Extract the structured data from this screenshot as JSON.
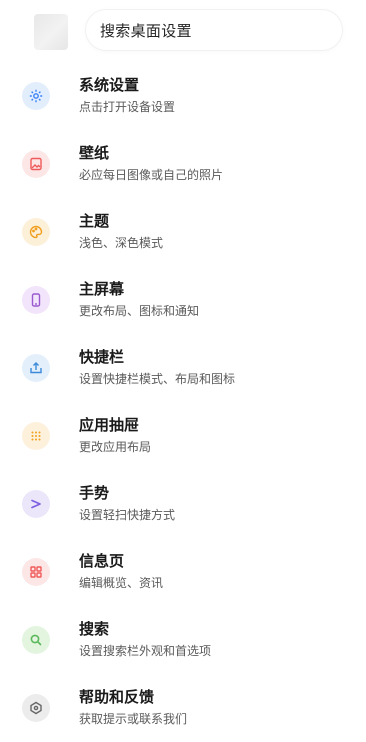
{
  "search": {
    "placeholder": "搜索桌面设置"
  },
  "items": [
    {
      "title": "系统设置",
      "subtitle": "点击打开设备设置",
      "icon": "gear-icon",
      "icon_color": "#3b82f6",
      "bg_color": "#e3eefc"
    },
    {
      "title": "壁纸",
      "subtitle": "必应每日图像或自己的照片",
      "icon": "picture-icon",
      "icon_color": "#ef5a5a",
      "bg_color": "#fde6e6"
    },
    {
      "title": "主题",
      "subtitle": "浅色、深色模式",
      "icon": "palette-icon",
      "icon_color": "#f0a020",
      "bg_color": "#fdf0d8"
    },
    {
      "title": "主屏幕",
      "subtitle": "更改布局、图标和通知",
      "icon": "phone-icon",
      "icon_color": "#9b59d0",
      "bg_color": "#f1e4fb"
    },
    {
      "title": "快捷栏",
      "subtitle": "设置快捷栏模式、布局和图标",
      "icon": "upload-tray-icon",
      "icon_color": "#3b8ad8",
      "bg_color": "#e3effb"
    },
    {
      "title": "应用抽屉",
      "subtitle": "更改应用布局",
      "icon": "grid-dots-icon",
      "icon_color": "#f0a020",
      "bg_color": "#fdf1dc"
    },
    {
      "title": "手势",
      "subtitle": "设置轻扫快捷方式",
      "icon": "gesture-chevron-icon",
      "icon_color": "#7c5ce0",
      "bg_color": "#ece6fb"
    },
    {
      "title": "信息页",
      "subtitle": "编辑概览、资讯",
      "icon": "feed-grid-icon",
      "icon_color": "#ef5a5a",
      "bg_color": "#fde6e6"
    },
    {
      "title": "搜索",
      "subtitle": "设置搜索栏外观和首选项",
      "icon": "search-icon",
      "icon_color": "#5cb85c",
      "bg_color": "#e3f5df"
    },
    {
      "title": "帮助和反馈",
      "subtitle": "获取提示或联系我们",
      "icon": "help-icon",
      "icon_color": "#666666",
      "bg_color": "#ececec"
    }
  ]
}
